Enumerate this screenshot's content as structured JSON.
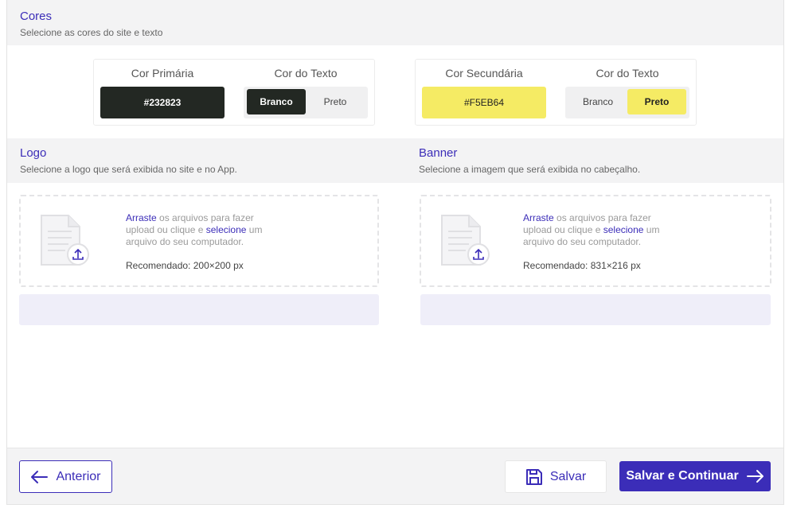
{
  "colors": {
    "title": "Cores",
    "subtitle": "Selecione as cores do site e texto",
    "primary": {
      "label": "Cor Primária",
      "value": "#232823",
      "text_label": "Cor do Texto",
      "options": [
        "Branco",
        "Preto"
      ],
      "selected": "Branco"
    },
    "secondary": {
      "label": "Cor Secundária",
      "value": "#F5EB64",
      "text_label": "Cor do Texto",
      "options": [
        "Branco",
        "Preto"
      ],
      "selected": "Preto"
    }
  },
  "logo": {
    "title": "Logo",
    "subtitle": "Selecione a logo que será exibida no site e no App.",
    "drop_link1": "Arraste",
    "drop_text1": " os arquivos para fazer upload ou clique e ",
    "drop_link2": "selecione",
    "drop_text2": " um arquivo do seu computador.",
    "recommended": "Recomendado: 200×200 px"
  },
  "banner": {
    "title": "Banner",
    "subtitle": "Selecione a imagem que será exibida no cabeçalho.",
    "drop_link1": "Arraste",
    "drop_text1": " os arquivos para fazer upload ou clique e ",
    "drop_link2": "selecione",
    "drop_text2": " um arquivo do seu computador.",
    "recommended": "Recomendado: 831×216 px"
  },
  "footer": {
    "prev_label": "Anterior",
    "save_label": "Salvar",
    "next_label": "Salvar e Continuar"
  },
  "theme": {
    "accent": "#3b2db8",
    "primary_swatch": "#232823",
    "secondary_swatch": "#F5EB64"
  },
  "icons": [
    "arrow-left-icon",
    "save-disk-icon",
    "arrow-right-icon",
    "file-upload-icon"
  ]
}
